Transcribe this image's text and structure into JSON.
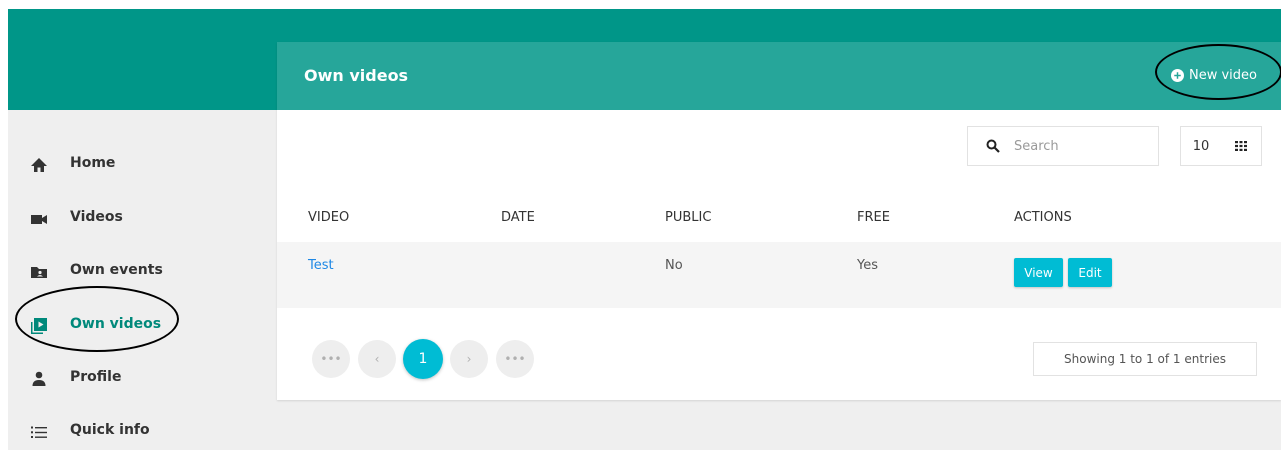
{
  "sidebar": {
    "items": [
      {
        "label": "Home",
        "icon": "home-icon"
      },
      {
        "label": "Videos",
        "icon": "video-camera-icon"
      },
      {
        "label": "Own events",
        "icon": "folder-user-icon"
      },
      {
        "label": "Own videos",
        "icon": "video-library-icon"
      },
      {
        "label": "Profile",
        "icon": "person-icon"
      },
      {
        "label": "Quick info",
        "icon": "list-icon"
      }
    ],
    "active_label": "Own videos"
  },
  "card": {
    "title": "Own videos",
    "new_video_label": "New video"
  },
  "search": {
    "placeholder": "Search"
  },
  "page_size": {
    "value": "10"
  },
  "table": {
    "headers": [
      "VIDEO",
      "DATE",
      "PUBLIC",
      "FREE",
      "ACTIONS"
    ],
    "rows": [
      {
        "video": "Test",
        "date": "",
        "public": "No",
        "free": "Yes",
        "view_label": "View",
        "edit_label": "Edit"
      }
    ]
  },
  "pagination": {
    "first": "•••",
    "prev": "‹",
    "current": "1",
    "next": "›",
    "last": "•••",
    "info": "Showing 1 to 1 of 1 entries"
  },
  "colors": {
    "topbar": "#009688",
    "card_header": "#26a69a",
    "accent": "#00bcd4",
    "active_nav": "#00897b",
    "link": "#1e88e5"
  }
}
